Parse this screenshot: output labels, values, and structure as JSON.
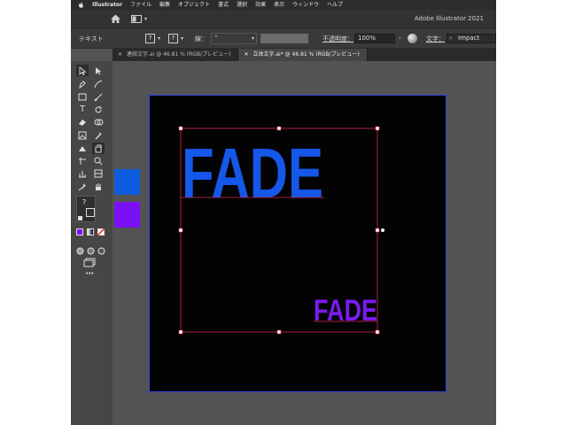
{
  "menu": {
    "app_name": "Illustrator",
    "items": [
      "ファイル",
      "編集",
      "オブジェクト",
      "書式",
      "選択",
      "効果",
      "表示",
      "ウィンドウ",
      "ヘルプ"
    ]
  },
  "appbar": {
    "title": "Adobe Illustrator 2021"
  },
  "control": {
    "mode_label": "テキスト",
    "q1": "?",
    "q2": "?",
    "stroke_label": "線：",
    "opacity_label": "不透明度：",
    "opacity_value": "100%",
    "font_label": "文字：",
    "font_value": "Impact"
  },
  "tabs": [
    {
      "label": "連続文字.ai @ 46.81 % (RGB/プレビュー)",
      "active": false
    },
    {
      "label": "立体文字.ai* @ 46.81 % (RGB/プレビュー)",
      "active": true
    }
  ],
  "toolbar": {
    "question_mark": "?",
    "more": "•••"
  },
  "swatches": {
    "blue": "#0f5ce0",
    "purple": "#7a11f5"
  },
  "canvas": {
    "big_text": "FADE",
    "small_text": "FADE",
    "big_color": "#1557e8",
    "small_color": "#7a1bf0",
    "artboard_color": "#030303",
    "selection_color": "#d6284a"
  }
}
